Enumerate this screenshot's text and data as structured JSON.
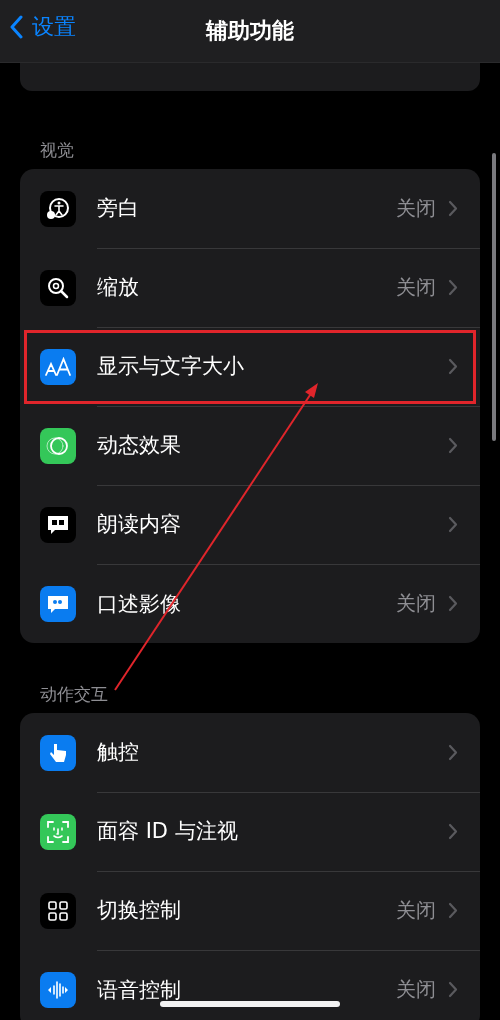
{
  "nav": {
    "back": "设置",
    "title": "辅助功能"
  },
  "sections": [
    {
      "header": "视觉",
      "rows": [
        {
          "label": "旁白",
          "value": "关闭",
          "color": "#000000",
          "highlighted": false
        },
        {
          "label": "缩放",
          "value": "关闭",
          "color": "#000000",
          "highlighted": false
        },
        {
          "label": "显示与文字大小",
          "color": "#0a7cf0",
          "highlighted": true
        },
        {
          "label": "动态效果",
          "color": "#34c759",
          "highlighted": false
        },
        {
          "label": "朗读内容",
          "color": "#000000",
          "highlighted": false
        },
        {
          "label": "口述影像",
          "value": "关闭",
          "color": "#0a7cf0",
          "highlighted": false
        }
      ]
    },
    {
      "header": "动作交互",
      "rows": [
        {
          "label": "触控",
          "color": "#0a7cf0",
          "highlighted": false
        },
        {
          "label": "面容 ID 与注视",
          "color": "#34c759",
          "highlighted": false
        },
        {
          "label": "切换控制",
          "value": "关闭",
          "color": "#000000",
          "highlighted": false
        },
        {
          "label": "语音控制",
          "value": "关闭",
          "color": "#0a7cf0",
          "highlighted": false
        }
      ]
    }
  ]
}
